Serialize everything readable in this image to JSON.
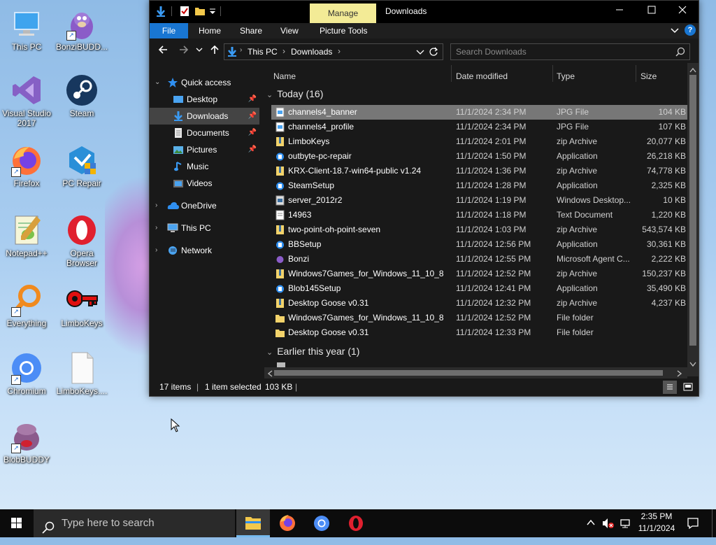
{
  "desktop": {
    "icons": [
      {
        "label": "This PC"
      },
      {
        "label": "BonziBUDD..."
      },
      {
        "label": "Visual Studio 2017"
      },
      {
        "label": "Steam"
      },
      {
        "label": "Firefox"
      },
      {
        "label": "PC Repair"
      },
      {
        "label": "Notepad++"
      },
      {
        "label": "Opera Browser"
      },
      {
        "label": "Everything"
      },
      {
        "label": "LimboKeys"
      },
      {
        "label": "Chromium"
      },
      {
        "label": "LimboKeys...."
      },
      {
        "label": "BlobBUDDY"
      }
    ]
  },
  "window": {
    "title": "Downloads",
    "manage_tab": "Manage",
    "ribbon_tabs": [
      "File",
      "Home",
      "Share",
      "View",
      "Picture Tools"
    ],
    "breadcrumb": [
      "This PC",
      "Downloads"
    ],
    "search_placeholder": "Search Downloads",
    "nav": {
      "quick_access": "Quick access",
      "items": [
        "Desktop",
        "Downloads",
        "Documents",
        "Pictures",
        "Music",
        "Videos"
      ],
      "onedrive": "OneDrive",
      "this_pc": "This PC",
      "network": "Network"
    },
    "columns": [
      "Name",
      "Date modified",
      "Type",
      "Size"
    ],
    "group_today": "Today (16)",
    "group_earlier": "Earlier this year (1)",
    "files": [
      {
        "name": "channels4_banner",
        "date": "11/1/2024 2:34 PM",
        "type": "JPG File",
        "size": "104 KB"
      },
      {
        "name": "channels4_profile",
        "date": "11/1/2024 2:34 PM",
        "type": "JPG File",
        "size": "107 KB"
      },
      {
        "name": "LimboKeys",
        "date": "11/1/2024 2:01 PM",
        "type": "zip Archive",
        "size": "20,077 KB"
      },
      {
        "name": "outbyte-pc-repair",
        "date": "11/1/2024 1:50 PM",
        "type": "Application",
        "size": "26,218 KB"
      },
      {
        "name": "KRX-Client-18.7-win64-public v1.24",
        "date": "11/1/2024 1:36 PM",
        "type": "zip Archive",
        "size": "74,778 KB"
      },
      {
        "name": "SteamSetup",
        "date": "11/1/2024 1:28 PM",
        "type": "Application",
        "size": "2,325 KB"
      },
      {
        "name": "server_2012r2",
        "date": "11/1/2024 1:19 PM",
        "type": "Windows Desktop...",
        "size": "10 KB"
      },
      {
        "name": "14963",
        "date": "11/1/2024 1:18 PM",
        "type": "Text Document",
        "size": "1,220 KB"
      },
      {
        "name": "two-point-oh-point-seven",
        "date": "11/1/2024 1:03 PM",
        "type": "zip Archive",
        "size": "543,574 KB"
      },
      {
        "name": "BBSetup",
        "date": "11/1/2024 12:56 PM",
        "type": "Application",
        "size": "30,361 KB"
      },
      {
        "name": "Bonzi",
        "date": "11/1/2024 12:55 PM",
        "type": "Microsoft Agent C...",
        "size": "2,222 KB"
      },
      {
        "name": "Windows7Games_for_Windows_11_10_8",
        "date": "11/1/2024 12:52 PM",
        "type": "zip Archive",
        "size": "150,237 KB"
      },
      {
        "name": "Blob145Setup",
        "date": "11/1/2024 12:41 PM",
        "type": "Application",
        "size": "35,490 KB"
      },
      {
        "name": "Desktop Goose v0.31",
        "date": "11/1/2024 12:32 PM",
        "type": "zip Archive",
        "size": "4,237 KB"
      },
      {
        "name": "Windows7Games_for_Windows_11_10_8",
        "date": "11/1/2024 12:52 PM",
        "type": "File folder",
        "size": ""
      },
      {
        "name": "Desktop Goose v0.31",
        "date": "11/1/2024 12:33 PM",
        "type": "File folder",
        "size": ""
      }
    ],
    "status": {
      "items": "17 items",
      "selected": "1 item selected",
      "size": "103 KB"
    }
  },
  "taskbar": {
    "search_placeholder": "Type here to search",
    "time": "2:35 PM",
    "date": "11/1/2024"
  },
  "colors": {
    "accent": "#1976d2",
    "manage_tab": "#f3eb96",
    "selection": "#777777"
  }
}
